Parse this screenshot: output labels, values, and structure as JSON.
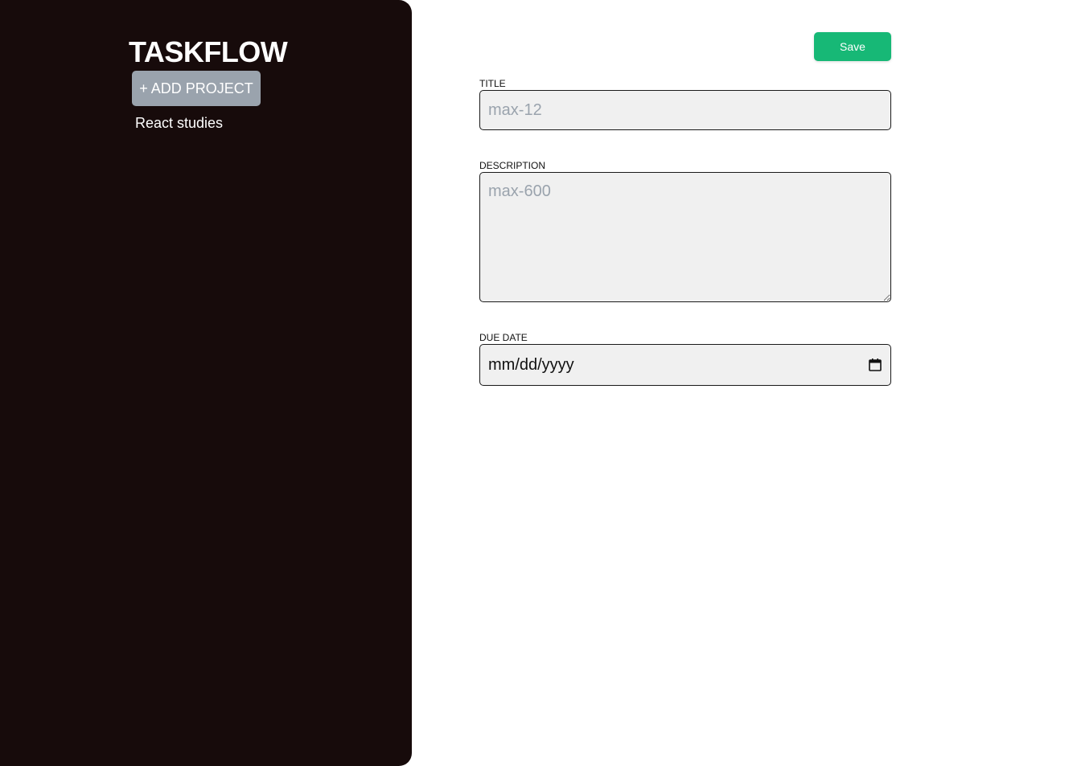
{
  "sidebar": {
    "brand": "TASKFLOW",
    "add_project_label": "+ ADD PROJECT",
    "projects": [
      {
        "label": "React studies"
      }
    ]
  },
  "form": {
    "save_label": "Save",
    "title": {
      "label": "TITLE",
      "placeholder": "max-12",
      "value": ""
    },
    "description": {
      "label": "DESCRIPTION",
      "placeholder": "max-600",
      "value": ""
    },
    "due_date": {
      "label": "DUE DATE",
      "placeholder": "mm/dd/yyyy",
      "icon": "calendar-icon"
    }
  },
  "colors": {
    "sidebar_bg": "#170b0b",
    "add_project_bg": "#9aa3ad",
    "save_bg": "#17b876",
    "field_bg": "#f0f0f0"
  }
}
